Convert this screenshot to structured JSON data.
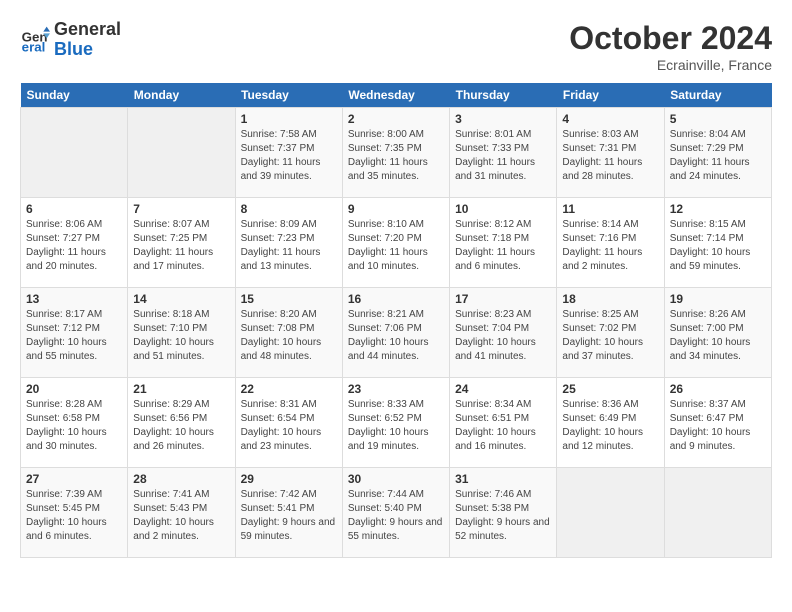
{
  "header": {
    "logo_line1": "General",
    "logo_line2": "Blue",
    "month": "October 2024",
    "location": "Ecrainville, France"
  },
  "weekdays": [
    "Sunday",
    "Monday",
    "Tuesday",
    "Wednesday",
    "Thursday",
    "Friday",
    "Saturday"
  ],
  "weeks": [
    [
      {
        "day": "",
        "info": ""
      },
      {
        "day": "",
        "info": ""
      },
      {
        "day": "1",
        "info": "Sunrise: 7:58 AM\nSunset: 7:37 PM\nDaylight: 11 hours and 39 minutes."
      },
      {
        "day": "2",
        "info": "Sunrise: 8:00 AM\nSunset: 7:35 PM\nDaylight: 11 hours and 35 minutes."
      },
      {
        "day": "3",
        "info": "Sunrise: 8:01 AM\nSunset: 7:33 PM\nDaylight: 11 hours and 31 minutes."
      },
      {
        "day": "4",
        "info": "Sunrise: 8:03 AM\nSunset: 7:31 PM\nDaylight: 11 hours and 28 minutes."
      },
      {
        "day": "5",
        "info": "Sunrise: 8:04 AM\nSunset: 7:29 PM\nDaylight: 11 hours and 24 minutes."
      }
    ],
    [
      {
        "day": "6",
        "info": "Sunrise: 8:06 AM\nSunset: 7:27 PM\nDaylight: 11 hours and 20 minutes."
      },
      {
        "day": "7",
        "info": "Sunrise: 8:07 AM\nSunset: 7:25 PM\nDaylight: 11 hours and 17 minutes."
      },
      {
        "day": "8",
        "info": "Sunrise: 8:09 AM\nSunset: 7:23 PM\nDaylight: 11 hours and 13 minutes."
      },
      {
        "day": "9",
        "info": "Sunrise: 8:10 AM\nSunset: 7:20 PM\nDaylight: 11 hours and 10 minutes."
      },
      {
        "day": "10",
        "info": "Sunrise: 8:12 AM\nSunset: 7:18 PM\nDaylight: 11 hours and 6 minutes."
      },
      {
        "day": "11",
        "info": "Sunrise: 8:14 AM\nSunset: 7:16 PM\nDaylight: 11 hours and 2 minutes."
      },
      {
        "day": "12",
        "info": "Sunrise: 8:15 AM\nSunset: 7:14 PM\nDaylight: 10 hours and 59 minutes."
      }
    ],
    [
      {
        "day": "13",
        "info": "Sunrise: 8:17 AM\nSunset: 7:12 PM\nDaylight: 10 hours and 55 minutes."
      },
      {
        "day": "14",
        "info": "Sunrise: 8:18 AM\nSunset: 7:10 PM\nDaylight: 10 hours and 51 minutes."
      },
      {
        "day": "15",
        "info": "Sunrise: 8:20 AM\nSunset: 7:08 PM\nDaylight: 10 hours and 48 minutes."
      },
      {
        "day": "16",
        "info": "Sunrise: 8:21 AM\nSunset: 7:06 PM\nDaylight: 10 hours and 44 minutes."
      },
      {
        "day": "17",
        "info": "Sunrise: 8:23 AM\nSunset: 7:04 PM\nDaylight: 10 hours and 41 minutes."
      },
      {
        "day": "18",
        "info": "Sunrise: 8:25 AM\nSunset: 7:02 PM\nDaylight: 10 hours and 37 minutes."
      },
      {
        "day": "19",
        "info": "Sunrise: 8:26 AM\nSunset: 7:00 PM\nDaylight: 10 hours and 34 minutes."
      }
    ],
    [
      {
        "day": "20",
        "info": "Sunrise: 8:28 AM\nSunset: 6:58 PM\nDaylight: 10 hours and 30 minutes."
      },
      {
        "day": "21",
        "info": "Sunrise: 8:29 AM\nSunset: 6:56 PM\nDaylight: 10 hours and 26 minutes."
      },
      {
        "day": "22",
        "info": "Sunrise: 8:31 AM\nSunset: 6:54 PM\nDaylight: 10 hours and 23 minutes."
      },
      {
        "day": "23",
        "info": "Sunrise: 8:33 AM\nSunset: 6:52 PM\nDaylight: 10 hours and 19 minutes."
      },
      {
        "day": "24",
        "info": "Sunrise: 8:34 AM\nSunset: 6:51 PM\nDaylight: 10 hours and 16 minutes."
      },
      {
        "day": "25",
        "info": "Sunrise: 8:36 AM\nSunset: 6:49 PM\nDaylight: 10 hours and 12 minutes."
      },
      {
        "day": "26",
        "info": "Sunrise: 8:37 AM\nSunset: 6:47 PM\nDaylight: 10 hours and 9 minutes."
      }
    ],
    [
      {
        "day": "27",
        "info": "Sunrise: 7:39 AM\nSunset: 5:45 PM\nDaylight: 10 hours and 6 minutes."
      },
      {
        "day": "28",
        "info": "Sunrise: 7:41 AM\nSunset: 5:43 PM\nDaylight: 10 hours and 2 minutes."
      },
      {
        "day": "29",
        "info": "Sunrise: 7:42 AM\nSunset: 5:41 PM\nDaylight: 9 hours and 59 minutes."
      },
      {
        "day": "30",
        "info": "Sunrise: 7:44 AM\nSunset: 5:40 PM\nDaylight: 9 hours and 55 minutes."
      },
      {
        "day": "31",
        "info": "Sunrise: 7:46 AM\nSunset: 5:38 PM\nDaylight: 9 hours and 52 minutes."
      },
      {
        "day": "",
        "info": ""
      },
      {
        "day": "",
        "info": ""
      }
    ]
  ]
}
